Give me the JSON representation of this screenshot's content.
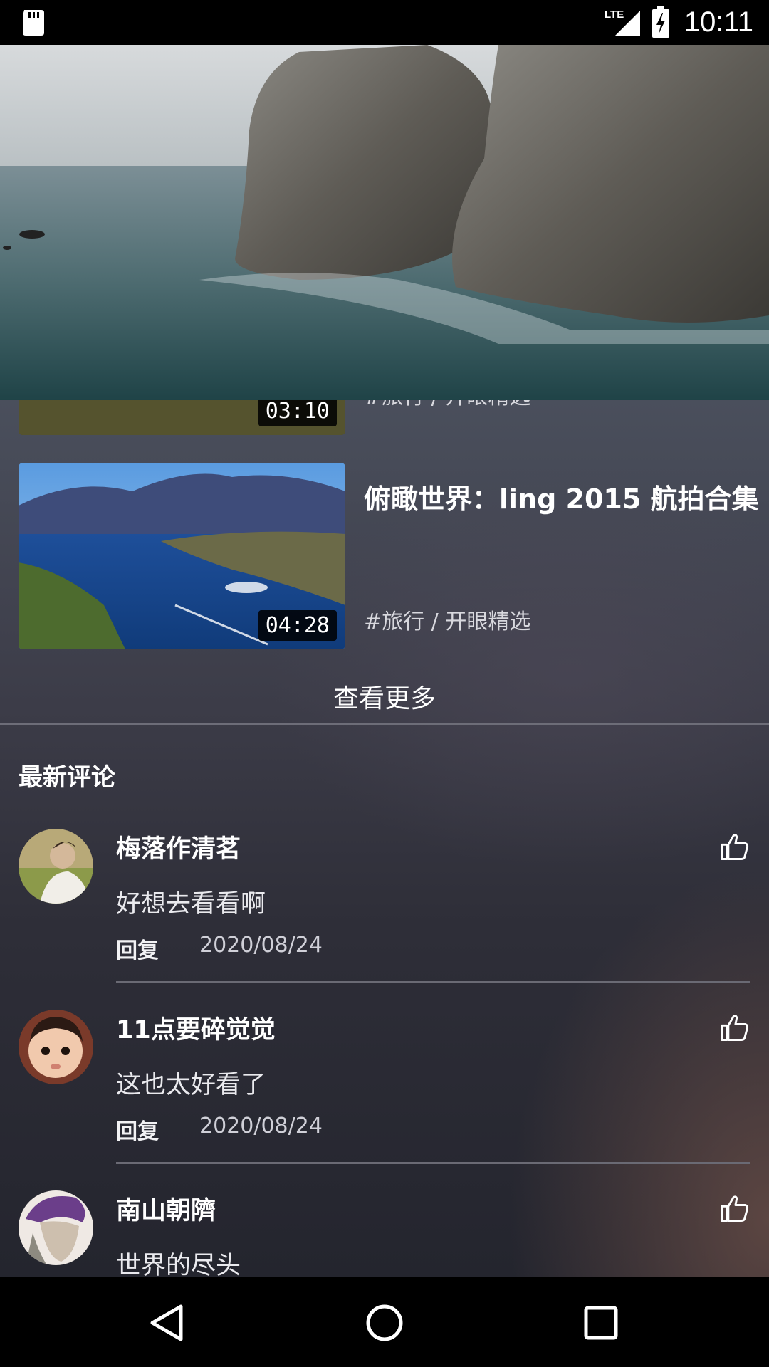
{
  "status_bar": {
    "time": "10:11",
    "network": "LTE"
  },
  "videos": [
    {
      "duration": "03:10",
      "title": "",
      "tag": "#旅行 / 开眼精选"
    },
    {
      "duration": "04:28",
      "title": "俯瞰世界：ling 2015 航拍合集",
      "tag": "#旅行 / 开眼精选"
    }
  ],
  "see_more_label": "查看更多",
  "comments_section": {
    "title": "最新评论",
    "reply_label": "回复",
    "items": [
      {
        "name": "梅落作清茗",
        "text": "好想去看看啊",
        "date": "2020/08/24"
      },
      {
        "name": "11点要碎觉觉",
        "text": "这也太好看了",
        "date": "2020/08/24"
      },
      {
        "name": "南山朝隮",
        "text": "世界的尽头",
        "date": ""
      }
    ]
  },
  "icons": [
    "sd-card-icon",
    "lte-signal-icon",
    "battery-charging-icon",
    "thumbs-up-icon",
    "back-icon",
    "home-icon",
    "recents-icon"
  ]
}
